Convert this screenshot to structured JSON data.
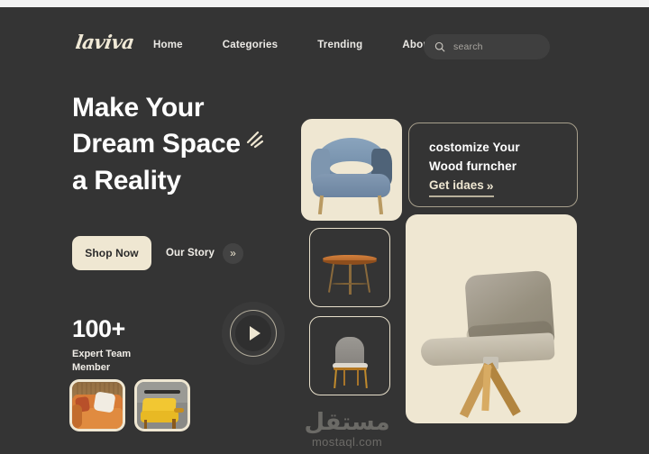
{
  "brand": {
    "logo_text": "laviva"
  },
  "nav": {
    "links": [
      {
        "label": "Home"
      },
      {
        "label": "Categories"
      },
      {
        "label": "Trending"
      },
      {
        "label": "About us"
      }
    ],
    "search": {
      "placeholder": "search",
      "icon": "search-icon"
    }
  },
  "hero": {
    "headline_line1": "Make Your",
    "headline_line2": "Dream Space",
    "headline_line3": "a Reality",
    "sparkle_icon": "sparkle-icon",
    "primary_cta": "Shop Now",
    "secondary_cta": "Our Story",
    "secondary_cta_icon": "double-chevron-right-icon"
  },
  "stats": {
    "number": "100+",
    "label_line1": "Expert Team",
    "label_line2": "Member"
  },
  "thumbnails": [
    {
      "name": "orange-sofa-thumbnail"
    },
    {
      "name": "yellow-armchair-thumbnail"
    }
  ],
  "video": {
    "icon": "play-icon"
  },
  "products": [
    {
      "name": "blue-armchair",
      "background": "#efe7d2"
    },
    {
      "name": "copper-stool",
      "background": "#343434"
    },
    {
      "name": "grey-dining-chair",
      "background": "#343434"
    }
  ],
  "promo_card": {
    "line1": "costomize  Your",
    "line2": "Wood furncher",
    "link_label": "Get idaes",
    "link_icon": "double-chevron-right-icon"
  },
  "feature_image": {
    "name": "beige-swivel-chair"
  },
  "watermark": {
    "arabic": "مستقل",
    "domain": "mostaql.com"
  },
  "colors": {
    "page_background": "#343434",
    "cream": "#efe7d2",
    "text_primary": "#ffffff",
    "muted": "#a9a6a0",
    "outline": "#a79f8c"
  }
}
